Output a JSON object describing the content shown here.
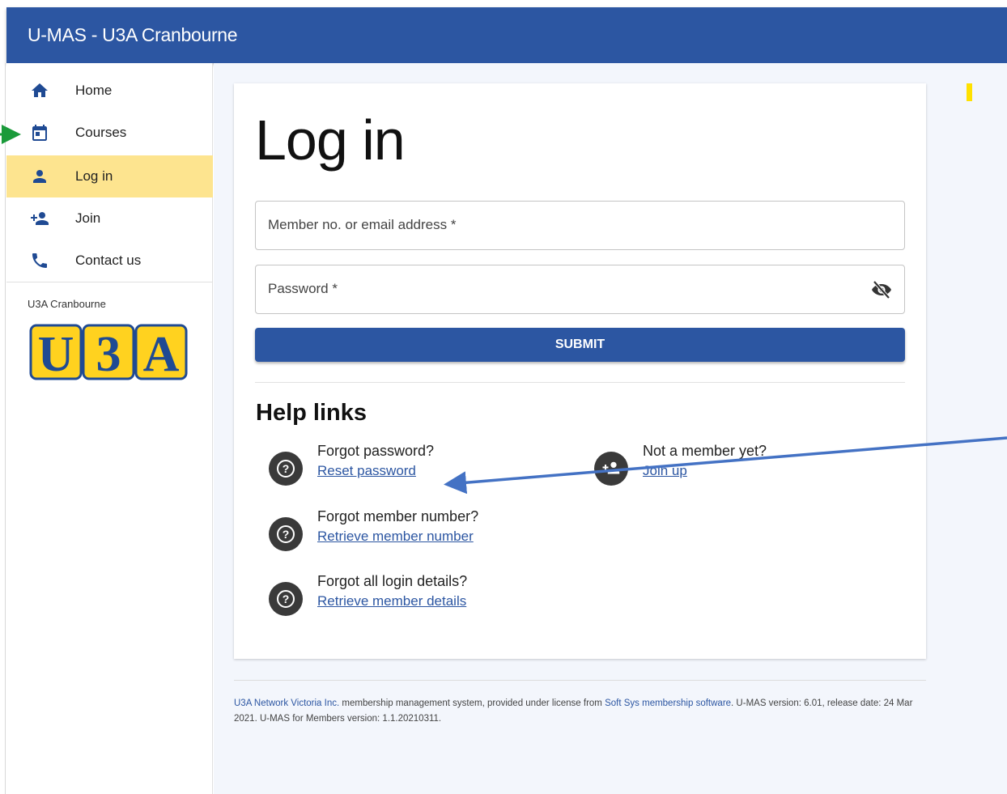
{
  "app": {
    "title": "U-MAS - U3A Cranbourne"
  },
  "sidebar": {
    "items": [
      {
        "label": "Home",
        "icon": "home-icon"
      },
      {
        "label": "Courses",
        "icon": "calendar-icon"
      },
      {
        "label": "Log in",
        "icon": "person-icon",
        "active": true
      },
      {
        "label": "Join",
        "icon": "person-add-icon"
      },
      {
        "label": "Contact us",
        "icon": "phone-icon"
      }
    ],
    "org_name": "U3A Cranbourne",
    "logo_text": "U3A"
  },
  "login": {
    "heading": "Log in",
    "member_field": {
      "placeholder": "Member no. or email address *"
    },
    "password_field": {
      "placeholder": "Password *"
    },
    "submit_label": "SUBMIT"
  },
  "help": {
    "title": "Help links",
    "links": [
      {
        "question": "Forgot password?",
        "link": "Reset password"
      },
      {
        "question": "Forgot member number?",
        "link": "Retrieve member number"
      },
      {
        "question": "Forgot all login details?",
        "link": "Retrieve member details"
      },
      {
        "question": "Not a member yet?",
        "link": "Join up"
      }
    ]
  },
  "footer": {
    "link1": "U3A Network Victoria Inc.",
    "text1": " membership management system, provided under license from ",
    "link2": "Soft Sys membership software",
    "text2": ". U-MAS version: 6.01, release date: 24 Mar 2021. U-MAS for Members version: 1.1.20210311."
  },
  "colors": {
    "primary": "#2c56a2",
    "active_nav": "#fde48f",
    "annotation_green": "#1a9a3a",
    "annotation_blue": "#4472c4",
    "marker_yellow": "#ffe100"
  }
}
